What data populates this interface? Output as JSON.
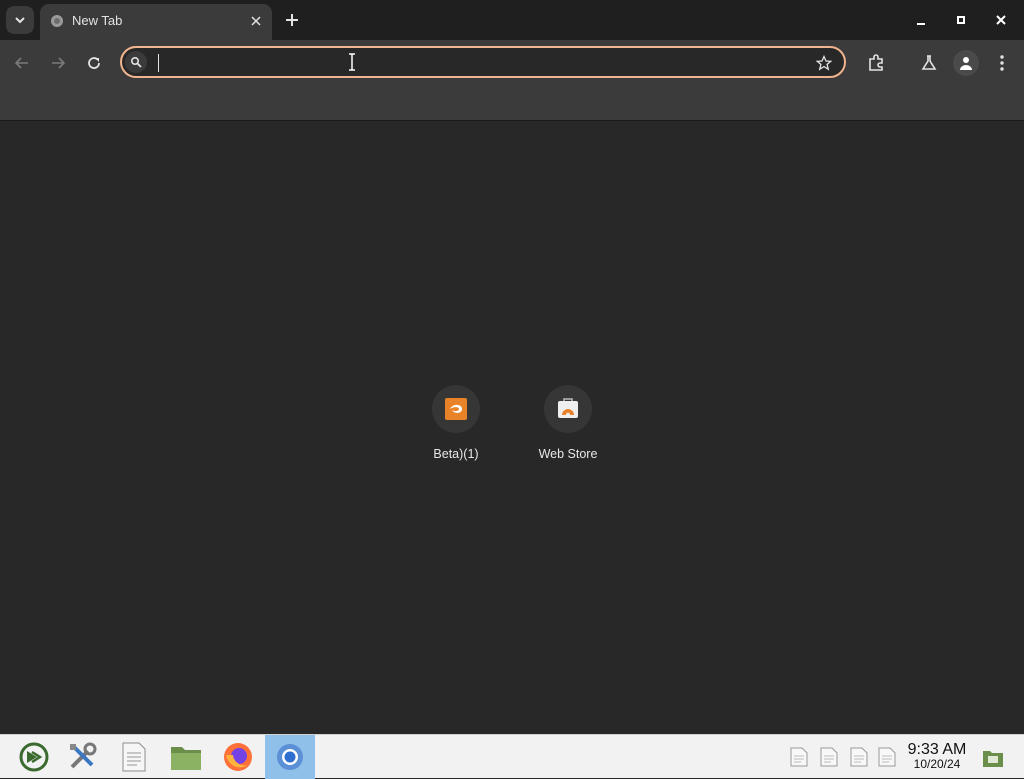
{
  "browser": {
    "tab": {
      "title": "New Tab"
    },
    "omnibox": {
      "value": "",
      "placeholder": ""
    }
  },
  "shortcuts": [
    {
      "label": "Beta)(1)",
      "icon": "orange-app-icon"
    },
    {
      "label": "Web Store",
      "icon": "web-store-icon"
    }
  ],
  "taskbar": {
    "apps": [
      "mint-menu-icon",
      "settings-tools-icon",
      "text-editor-icon",
      "file-manager-icon",
      "firefox-icon",
      "chrome-icon"
    ],
    "active_app": "chrome-icon",
    "clock": {
      "time": "9:33 AM",
      "date": "10/20/24"
    }
  },
  "colors": {
    "accent": "#f0b48e",
    "background": "#282828",
    "toolbar": "#3b3b3b",
    "taskbar_active": "#8ec0ea"
  }
}
